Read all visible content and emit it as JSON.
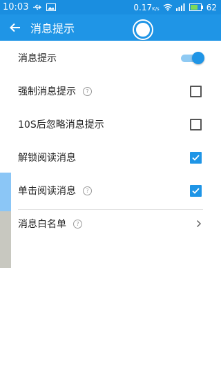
{
  "statusbar": {
    "time": "10:03",
    "net_speed": "0.17",
    "net_unit": "K/s",
    "battery": "62"
  },
  "appbar": {
    "title": "消息提示"
  },
  "settings": [
    {
      "label": "消息提示",
      "control": "toggle",
      "on": true
    },
    {
      "label": "强制消息提示",
      "help": "?",
      "control": "checkbox",
      "checked": false
    },
    {
      "label": "10S后忽略消息提示",
      "control": "checkbox",
      "checked": false
    },
    {
      "label": "解锁阅读消息",
      "control": "checkbox",
      "checked": true
    },
    {
      "label": "单击阅读消息",
      "help": "?",
      "control": "checkbox",
      "checked": true
    },
    {
      "label": "消息白名单",
      "help": "?",
      "control": "chevron"
    }
  ],
  "colors": {
    "accent": "#1f95e6",
    "statusbar": "#1a8ee0"
  }
}
